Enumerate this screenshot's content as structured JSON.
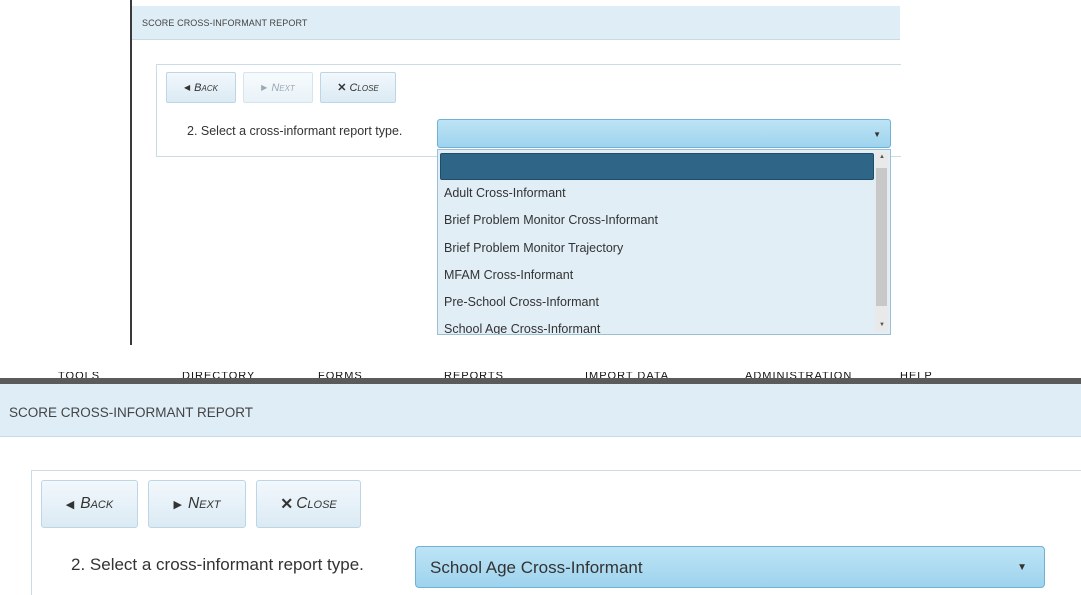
{
  "top_panel": {
    "header_title": "SCORE CROSS-INFORMANT REPORT",
    "back_label": "Back",
    "next_label": "Next",
    "close_label": "Close",
    "step_label": "2. Select a cross-informant report type.",
    "selected_value": "",
    "dropdown_options": [
      "",
      "Adult Cross-Informant",
      "Brief Problem Monitor Cross-Informant",
      "Brief Problem Monitor Trajectory",
      "MFAM Cross-Informant",
      "Pre-School Cross-Informant",
      "School Age Cross-Informant"
    ]
  },
  "bottom_panel": {
    "nav_menu_partial": [
      "TOOLS",
      "DIRECTORY",
      "FORMS",
      "REPORTS",
      "IMPORT DATA",
      "ADMINISTRATION",
      "HELP"
    ],
    "header_title": "SCORE CROSS-INFORMANT REPORT",
    "back_label": "Back",
    "next_label": "Next",
    "close_label": "Close",
    "step_label": "2. Select a cross-informant report type.",
    "selected_value": "School Age Cross-Informant"
  },
  "icons": {
    "back": "triangle-left-icon",
    "next": "triangle-right-icon",
    "close": "x-icon",
    "select_caret": "caret-down-icon"
  },
  "colors": {
    "header_bg": "#deedf6",
    "select_bg": "#a9daf0",
    "highlight": "#2f6587"
  }
}
